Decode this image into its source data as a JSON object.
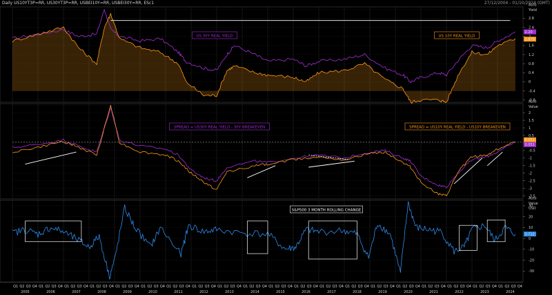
{
  "header": {
    "tickers": "Daily US10YT3P=RR, US30YT3P=RR, USBEI10Y=RR, USBEI30Y=RR, ESc1",
    "date_range": "27/12/2004 - 01/10/2024 (GMT)"
  },
  "colors": {
    "purple": "#a42fd6",
    "orange": "#ff9a1a",
    "blue": "#2d8ef0",
    "white": "#ffffff",
    "grid": "#2a2a2a",
    "panel_border": "#444444"
  },
  "panels": {
    "top": {
      "axis_title": "Yield",
      "ticks": [
        "3.2",
        "2.8",
        "2.4",
        "2",
        "1.6",
        "1.2",
        "0.8",
        "0.4",
        "0",
        "-0.4",
        "-0.8"
      ],
      "label_purple": "US 30Y REAL YIELD",
      "label_orange": "US 10Y REAL YIELD",
      "last_purple": "2.20",
      "last_orange": "1.879",
      "auto": "Auto"
    },
    "middle": {
      "axis_title": "Value",
      "ticks": [
        "2.5",
        "2",
        "1.5",
        "1",
        "0.5",
        "0",
        "-0.5",
        "-1",
        "-1.5",
        "-2",
        "-2.5",
        "-3",
        "-3.5"
      ],
      "label_purple": "SPREAD = US30Y REAL YIELD - 30Y BREAKEVEN",
      "label_orange": "SPREAD = US10Y REAL YIELD - US10Y BREAKEVEN",
      "last_orange": "0.051",
      "last_purple": "0.051",
      "auto": "Auto"
    },
    "bottom": {
      "axis_title": "Value",
      "axis_unit": "USD",
      "ticks": [
        "30",
        "20",
        "10",
        "0",
        "-10",
        "-20",
        "-30"
      ],
      "label": "S&P500 3 MONTH ROLLING CHANGE",
      "last_value": "3.712",
      "auto": "Auto"
    }
  },
  "x_axis": {
    "years": [
      "2005",
      "2006",
      "2007",
      "2008",
      "2009",
      "2010",
      "2011",
      "2012",
      "2013",
      "2014",
      "2015",
      "2016",
      "2017",
      "2018",
      "2019",
      "2020",
      "2021",
      "2022",
      "2023",
      "2024"
    ],
    "quarters": [
      "Q1",
      "Q2",
      "Q3",
      "Q4"
    ]
  },
  "chart_data": [
    {
      "type": "line",
      "title": "",
      "ylabel": "Yield",
      "ylim": [
        -0.9,
        3.3
      ],
      "grid": true,
      "x": [
        2005.0,
        2006.0,
        2007.0,
        2007.6,
        2008.3,
        2008.6,
        2008.85,
        2009.2,
        2010.0,
        2010.8,
        2011.5,
        2011.8,
        2012.5,
        2013.0,
        2013.4,
        2013.7,
        2014.5,
        2015.0,
        2016.0,
        2016.5,
        2017.0,
        2018.0,
        2018.8,
        2019.6,
        2020.3,
        2020.6,
        2021.0,
        2021.7,
        2022.0,
        2022.5,
        2023.0,
        2023.6,
        2024.0,
        2024.7
      ],
      "series": [
        {
          "name": "US 30Y REAL YIELD",
          "color": "#a42fd6",
          "values": [
            1.9,
            2.1,
            2.3,
            2.0,
            2.1,
            3.2,
            2.3,
            2.0,
            1.8,
            1.9,
            1.3,
            0.9,
            0.6,
            0.5,
            1.2,
            1.6,
            1.2,
            0.9,
            1.0,
            0.7,
            0.9,
            1.0,
            1.2,
            0.6,
            0.3,
            0.0,
            0.2,
            0.4,
            0.3,
            1.0,
            1.6,
            1.5,
            1.8,
            2.2
          ]
        },
        {
          "name": "US 10Y REAL YIELD",
          "color": "#ff9a1a",
          "values": [
            1.8,
            2.1,
            2.4,
            1.5,
            0.8,
            2.4,
            3.0,
            1.9,
            1.5,
            1.3,
            0.8,
            0.0,
            -0.6,
            -0.6,
            0.5,
            0.7,
            0.4,
            0.3,
            0.2,
            0.0,
            0.4,
            0.5,
            0.8,
            0.1,
            -0.3,
            -0.9,
            -0.8,
            -0.8,
            -0.9,
            0.4,
            1.3,
            1.2,
            1.6,
            1.9
          ]
        }
      ]
    },
    {
      "type": "line",
      "title": "",
      "ylabel": "Value",
      "ylim": [
        -3.7,
        2.6
      ],
      "grid": true,
      "x": [
        2005.0,
        2006.0,
        2007.0,
        2007.6,
        2008.3,
        2008.85,
        2009.2,
        2010.0,
        2011.0,
        2011.5,
        2012.0,
        2012.5,
        2013.0,
        2013.4,
        2014.5,
        2015.0,
        2016.0,
        2017.0,
        2018.0,
        2019.0,
        2019.6,
        2020.3,
        2020.6,
        2021.0,
        2021.7,
        2022.0,
        2022.5,
        2023.0,
        2023.6,
        2024.0,
        2024.7
      ],
      "series": [
        {
          "name": "SPREAD = US30Y REAL YIELD - 30Y BREAKEVEN",
          "color": "#a42fd6",
          "values": [
            -0.3,
            -0.1,
            0.2,
            -0.2,
            -0.6,
            2.3,
            0.2,
            -0.2,
            -0.4,
            -0.8,
            -1.8,
            -2.3,
            -2.5,
            -1.6,
            -1.2,
            -1.3,
            -1.0,
            -0.8,
            -1.0,
            -0.6,
            -0.5,
            -1.0,
            -1.2,
            -2.2,
            -2.8,
            -2.9,
            -1.9,
            -1.1,
            -0.9,
            -0.6,
            0.05
          ]
        },
        {
          "name": "SPREAD = US10Y REAL YIELD - US10Y BREAKEVEN",
          "color": "#ff9a1a",
          "values": [
            -0.6,
            -0.3,
            0.1,
            -0.3,
            -0.8,
            2.5,
            0.0,
            -0.6,
            -0.8,
            -1.2,
            -2.0,
            -2.6,
            -3.1,
            -1.9,
            -1.5,
            -1.4,
            -1.1,
            -0.9,
            -1.1,
            -0.7,
            -0.6,
            -1.3,
            -1.6,
            -2.6,
            -3.4,
            -3.5,
            -1.8,
            -0.9,
            -0.8,
            -0.4,
            0.05
          ]
        }
      ]
    },
    {
      "type": "line",
      "title": "S&P500 3 MONTH ROLLING CHANGE",
      "ylabel": "Value",
      "ylim": [
        -40,
        35
      ],
      "grid": true,
      "x": [
        2005.0,
        2005.5,
        2006.0,
        2006.5,
        2007.0,
        2007.6,
        2008.0,
        2008.4,
        2008.8,
        2009.0,
        2009.4,
        2009.8,
        2010.4,
        2010.8,
        2011.6,
        2011.9,
        2012.5,
        2013.0,
        2014.0,
        2015.0,
        2015.7,
        2016.1,
        2016.5,
        2017.0,
        2018.0,
        2018.5,
        2018.95,
        2019.3,
        2019.8,
        2020.2,
        2020.5,
        2020.8,
        2021.3,
        2021.8,
        2022.3,
        2022.7,
        2023.0,
        2023.5,
        2023.9,
        2024.3,
        2024.7
      ],
      "series": [
        {
          "name": "S&P500 3 MONTH ROLLING CHANGE",
          "color": "#2d8ef0",
          "values": [
            5,
            8,
            4,
            10,
            6,
            -2,
            -8,
            2,
            -35,
            -20,
            28,
            10,
            -8,
            10,
            -15,
            12,
            6,
            8,
            5,
            4,
            -10,
            -8,
            8,
            6,
            7,
            4,
            -18,
            14,
            4,
            -32,
            33,
            10,
            8,
            6,
            -12,
            -8,
            8,
            12,
            -2,
            10,
            4
          ]
        }
      ]
    }
  ],
  "trendlines_top": [
    {
      "x": [
        2008.85,
        2024.5
      ],
      "y": [
        2.7,
        2.7
      ]
    }
  ],
  "trendlines_middle": [
    {
      "x": [
        2005.5,
        2007.5
      ],
      "y": [
        -1.4,
        -0.6
      ],
      "dashed": false
    },
    {
      "x": [
        2014.2,
        2015.3
      ],
      "y": [
        -2.3,
        -1.5
      ],
      "dashed": false
    },
    {
      "x": [
        2016.6,
        2018.4
      ],
      "y": [
        -1.6,
        -1.2
      ],
      "dashed": false
    },
    {
      "x": [
        2016.6,
        2018.2
      ],
      "y": [
        -0.8,
        -1.1
      ],
      "dashed": true
    },
    {
      "x": [
        2022.3,
        2023.4
      ],
      "y": [
        -2.7,
        -1.0
      ],
      "dashed": false
    },
    {
      "x": [
        2023.6,
        2024.2
      ],
      "y": [
        -1.5,
        -0.6
      ],
      "dashed": false
    }
  ],
  "boxes_bottom": [
    {
      "x": [
        2005.5,
        2007.7
      ],
      "y": [
        -3,
        16
      ]
    },
    {
      "x": [
        2014.2,
        2015.0
      ],
      "y": [
        -14,
        16
      ]
    },
    {
      "x": [
        2016.6,
        2018.5
      ],
      "y": [
        -19,
        16
      ]
    },
    {
      "x": [
        2022.5,
        2023.2
      ],
      "y": [
        -11,
        12
      ]
    },
    {
      "x": [
        2023.6,
        2024.3
      ],
      "y": [
        -3,
        17
      ]
    }
  ],
  "hline_middle": 0.05
}
